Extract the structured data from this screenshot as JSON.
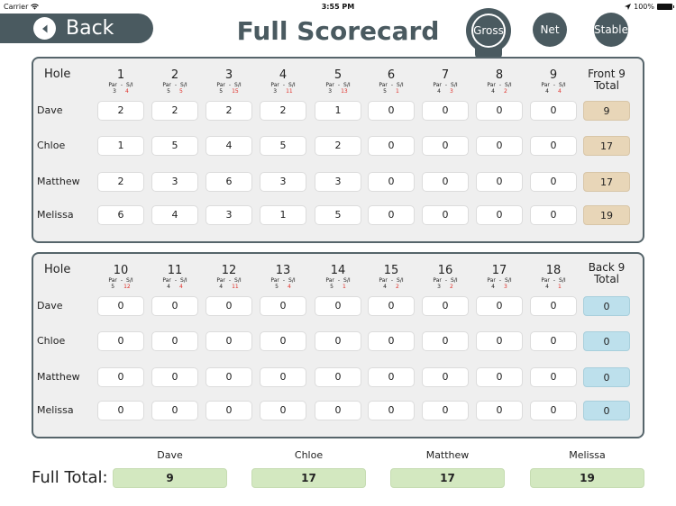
{
  "status_bar": {
    "carrier": "Carrier",
    "time": "3:55 PM",
    "battery": "100%"
  },
  "nav": {
    "back_label": "Back",
    "title": "Full Scorecard"
  },
  "modes": [
    {
      "label": "Gross",
      "active": true
    },
    {
      "label": "Net",
      "active": false
    },
    {
      "label": "Stable",
      "active": false
    }
  ],
  "hole_header": "Hole",
  "par_label": "Par",
  "si_label": "S/I",
  "front": {
    "total_header_line1": "Front 9",
    "total_header_line2": "Total",
    "holes": [
      {
        "num": "1",
        "par": "3",
        "si": "4"
      },
      {
        "num": "2",
        "par": "5",
        "si": "5"
      },
      {
        "num": "3",
        "par": "5",
        "si": "15"
      },
      {
        "num": "4",
        "par": "3",
        "si": "11"
      },
      {
        "num": "5",
        "par": "3",
        "si": "13"
      },
      {
        "num": "6",
        "par": "5",
        "si": "1"
      },
      {
        "num": "7",
        "par": "4",
        "si": "3"
      },
      {
        "num": "8",
        "par": "4",
        "si": "2"
      },
      {
        "num": "9",
        "par": "4",
        "si": "4"
      }
    ],
    "players": [
      {
        "name": "Dave",
        "scores": [
          "2",
          "2",
          "2",
          "2",
          "1",
          "0",
          "0",
          "0",
          "0"
        ],
        "total": "9"
      },
      {
        "name": "Chloe",
        "scores": [
          "1",
          "5",
          "4",
          "5",
          "2",
          "0",
          "0",
          "0",
          "0"
        ],
        "total": "17"
      },
      {
        "name": "Matthew",
        "scores": [
          "2",
          "3",
          "6",
          "3",
          "3",
          "0",
          "0",
          "0",
          "0"
        ],
        "total": "17"
      },
      {
        "name": "Melissa",
        "scores": [
          "6",
          "4",
          "3",
          "1",
          "5",
          "0",
          "0",
          "0",
          "0"
        ],
        "total": "19"
      }
    ]
  },
  "back": {
    "total_header_line1": "Back 9",
    "total_header_line2": "Total",
    "holes": [
      {
        "num": "10",
        "par": "5",
        "si": "12"
      },
      {
        "num": "11",
        "par": "4",
        "si": "4"
      },
      {
        "num": "12",
        "par": "4",
        "si": "11"
      },
      {
        "num": "13",
        "par": "5",
        "si": "4"
      },
      {
        "num": "14",
        "par": "5",
        "si": "1"
      },
      {
        "num": "15",
        "par": "4",
        "si": "2"
      },
      {
        "num": "16",
        "par": "3",
        "si": "2"
      },
      {
        "num": "17",
        "par": "4",
        "si": "3"
      },
      {
        "num": "18",
        "par": "4",
        "si": "1"
      }
    ],
    "players": [
      {
        "name": "Dave",
        "scores": [
          "0",
          "0",
          "0",
          "0",
          "0",
          "0",
          "0",
          "0",
          "0"
        ],
        "total": "0"
      },
      {
        "name": "Chloe",
        "scores": [
          "0",
          "0",
          "0",
          "0",
          "0",
          "0",
          "0",
          "0",
          "0"
        ],
        "total": "0"
      },
      {
        "name": "Matthew",
        "scores": [
          "0",
          "0",
          "0",
          "0",
          "0",
          "0",
          "0",
          "0",
          "0"
        ],
        "total": "0"
      },
      {
        "name": "Melissa",
        "scores": [
          "0",
          "0",
          "0",
          "0",
          "0",
          "0",
          "0",
          "0",
          "0"
        ],
        "total": "0"
      }
    ]
  },
  "full_total": {
    "label": "Full Total:",
    "players": [
      {
        "name": "Dave",
        "total": "9"
      },
      {
        "name": "Chloe",
        "total": "17"
      },
      {
        "name": "Matthew",
        "total": "17"
      },
      {
        "name": "Melissa",
        "total": "19"
      }
    ]
  },
  "colors": {
    "primary": "#4a5a60",
    "si_red": "#e0302a",
    "front_total_bg": "#e8d6b8",
    "back_total_bg": "#bde0ec",
    "full_total_bg": "#d3e8c0",
    "panel_bg": "#efefef"
  }
}
